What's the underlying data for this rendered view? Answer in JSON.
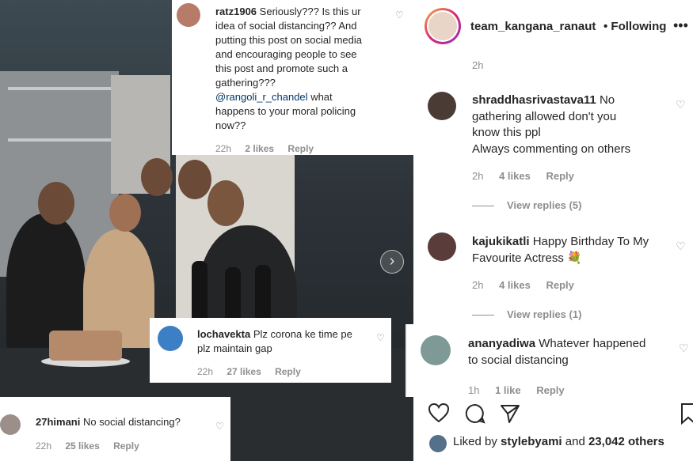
{
  "photo": {
    "next_icon": "chevron-right-icon"
  },
  "overlay_comments": [
    {
      "username": "ratz1906",
      "text_lines": [
        "Seriously??? Is this ur",
        "idea of social distancing?? And",
        "putting this post on social media",
        "and encouraging people to see",
        "this post and promote such a",
        "gathering???"
      ],
      "mention": "@rangoli_r_chandel",
      "text_after": [
        "what",
        "happens to your moral policing",
        "now??"
      ],
      "time": "22h",
      "likes": "2 likes",
      "reply": "Reply"
    },
    {
      "username": "lochavekta",
      "text_lines": [
        "Plz corona ke time pe",
        "plz maintain gap"
      ],
      "time": "22h",
      "likes": "27 likes",
      "reply": "Reply"
    },
    {
      "username": "27himani",
      "text_lines": [
        "No social distancing?"
      ],
      "time": "22h",
      "likes": "25 likes",
      "reply": "Reply"
    }
  ],
  "panel": {
    "header": {
      "username": "team_kangana_ranaut",
      "follow": "• Following",
      "more_icon": "more-icon"
    },
    "top_time": "2h",
    "comments": [
      {
        "username": "shraddhasrivastava11",
        "text_lines": [
          "No",
          "gathering allowed don't you",
          "know this ppl",
          "Always commenting on others"
        ],
        "time": "2h",
        "likes": "4 likes",
        "reply": "Reply",
        "view_replies": "View replies (5)"
      },
      {
        "username": "kajukikatli",
        "text_lines": [
          "Happy Birthday To My",
          "Favourite Actress"
        ],
        "emoji": "💐",
        "time": "2h",
        "likes": "4 likes",
        "reply": "Reply",
        "view_replies": "View replies (1)"
      },
      {
        "username": "ananyadiwa",
        "text_lines": [
          "Whatever happened",
          "to social distancing"
        ],
        "time": "1h",
        "likes": "1 like",
        "reply": "Reply"
      }
    ],
    "actions": {
      "like_icon": "heart-icon",
      "comment_icon": "comment-icon",
      "share_icon": "share-icon",
      "save_icon": "bookmark-icon"
    },
    "liked_by": {
      "prefix": "Liked by",
      "user": "stylebyami",
      "middle": "and",
      "others": "23,042 others"
    }
  }
}
